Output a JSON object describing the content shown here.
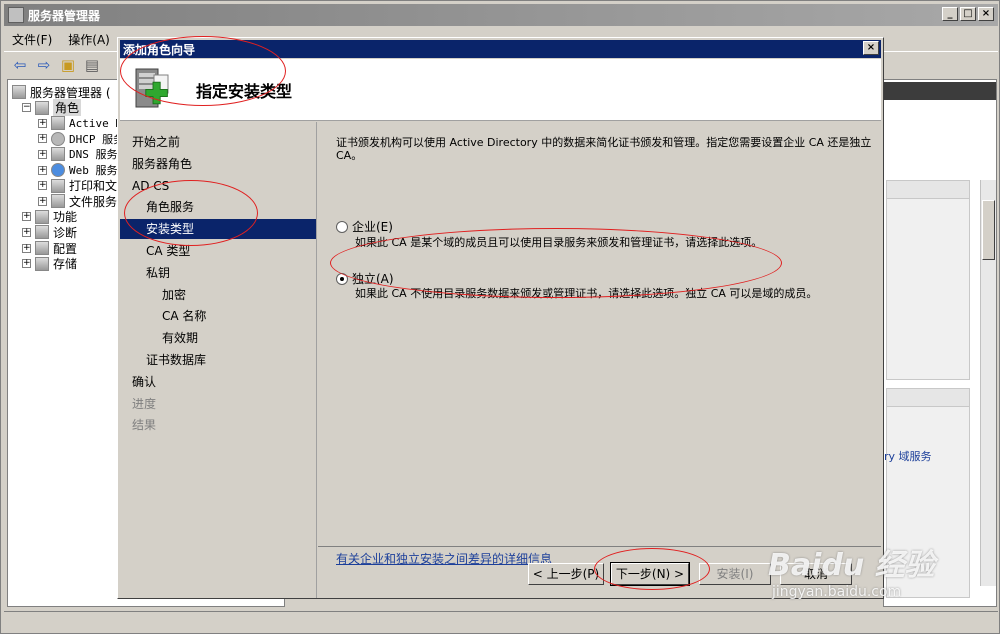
{
  "outer": {
    "title": "服务器管理器",
    "menu": [
      "文件(F)",
      "操作(A)"
    ],
    "tree": [
      {
        "label": "服务器管理器 (",
        "indent": 0,
        "expander": "",
        "icon": "server-icon"
      },
      {
        "label": "角色",
        "indent": 1,
        "expander": "⊟",
        "icon": "roles-icon",
        "selected": true
      },
      {
        "label": "Active D",
        "indent": 2,
        "expander": "⊞",
        "icon": "directory-icon",
        "mono": true
      },
      {
        "label": "DHCP 服务",
        "indent": 2,
        "expander": "⊞",
        "icon": "gear-icon",
        "mono": true
      },
      {
        "label": "DNS 服务",
        "indent": 2,
        "expander": "⊞",
        "icon": "dns-icon",
        "mono": true
      },
      {
        "label": "Web 服务",
        "indent": 2,
        "expander": "⊞",
        "icon": "globe-icon",
        "mono": true
      },
      {
        "label": "打印和文",
        "indent": 2,
        "expander": "⊞",
        "icon": "printer-icon"
      },
      {
        "label": "文件服务",
        "indent": 2,
        "expander": "⊞",
        "icon": "folder-icon"
      },
      {
        "label": "功能",
        "indent": 1,
        "expander": "⊞",
        "icon": "features-icon"
      },
      {
        "label": "诊断",
        "indent": 1,
        "expander": "⊞",
        "icon": "diagnostics-icon"
      },
      {
        "label": "配置",
        "indent": 1,
        "expander": "⊞",
        "icon": "configuration-icon"
      },
      {
        "label": "存储",
        "indent": 1,
        "expander": "⊞",
        "icon": "storage-icon"
      }
    ],
    "right_link": "ry 域服务"
  },
  "wizard": {
    "title": "添加角色向导",
    "heading": "指定安装类型",
    "nav": [
      {
        "label": "开始之前",
        "level": 0,
        "state": "normal"
      },
      {
        "label": "服务器角色",
        "level": 0,
        "state": "normal"
      },
      {
        "label": "AD CS",
        "level": 0,
        "state": "normal"
      },
      {
        "label": "角色服务",
        "level": 1,
        "state": "normal"
      },
      {
        "label": "安装类型",
        "level": 1,
        "state": "active"
      },
      {
        "label": "CA 类型",
        "level": 1,
        "state": "normal"
      },
      {
        "label": "私钥",
        "level": 1,
        "state": "normal"
      },
      {
        "label": "加密",
        "level": 2,
        "state": "normal"
      },
      {
        "label": "CA 名称",
        "level": 2,
        "state": "normal"
      },
      {
        "label": "有效期",
        "level": 2,
        "state": "normal"
      },
      {
        "label": "证书数据库",
        "level": 1,
        "state": "normal"
      },
      {
        "label": "确认",
        "level": 0,
        "state": "normal"
      },
      {
        "label": "进度",
        "level": 0,
        "state": "disabled"
      },
      {
        "label": "结果",
        "level": 0,
        "state": "disabled"
      }
    ],
    "intro": "证书颁发机构可以使用 Active Directory 中的数据来简化证书颁发和管理。指定您需要设置企业 CA 还是独立 CA。",
    "options": [
      {
        "label": "企业(E)",
        "description": "如果此 CA 是某个域的成员且可以使用目录服务来颁发和管理证书，请选择此选项。",
        "checked": false
      },
      {
        "label": "独立(A)",
        "description": "如果此 CA 不使用目录服务数据来颁发或管理证书，请选择此选项。独立 CA 可以是域的成员。",
        "checked": true
      }
    ],
    "details_link": "有关企业和独立安装之间差异的详细信息",
    "buttons": {
      "back": "< 上一步(P)",
      "next": "下一步(N) >",
      "install": "安装(I)",
      "cancel": "取消"
    }
  },
  "watermark": {
    "logo": "Baidu 经验",
    "sub": "jingyan.baidu.com"
  },
  "colors": {
    "title_active": "#0a246a",
    "annotation": "#e02020",
    "link": "#1c3f9a"
  }
}
